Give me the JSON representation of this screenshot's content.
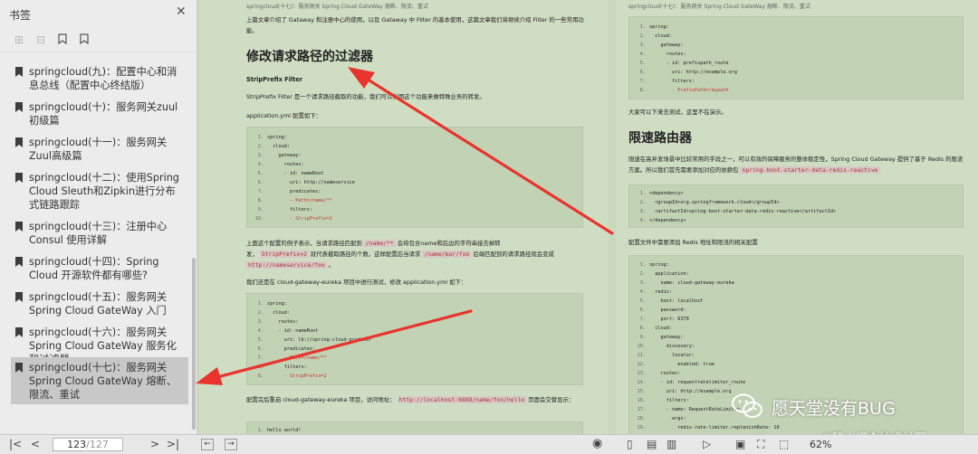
{
  "sidebar": {
    "title": "书签",
    "items": [
      {
        "label": "springcloud(九)：配置中心和消息总线（配置中心终结版）"
      },
      {
        "label": "springcloud(十)：服务网关zuul初级篇"
      },
      {
        "label": "springcloud(十一)：服务网关Zuul高级篇"
      },
      {
        "label": "springcloud(十二)：使用Spring Cloud Sleuth和Zipkin进行分布式链路跟踪"
      },
      {
        "label": "springcloud(十三)：注册中心 Consul 使用详解"
      },
      {
        "label": "springcloud(十四)：Spring Cloud 开源软件都有哪些?"
      },
      {
        "label": "springcloud(十五)：服务网关 Spring Cloud GateWay 入门"
      },
      {
        "label": "springcloud(十六)：服务网关 Spring Cloud GateWay 服务化和过滤器"
      },
      {
        "label": "springcloud(十七)：服务网关 Spring Cloud GateWay 熔断、限流、重试"
      }
    ]
  },
  "toolbar": {
    "current_page": "123",
    "total_pages": "/127",
    "zoom": "62%"
  },
  "left_page": {
    "running_head": "springcloud(十七)：服务网关 Spring Cloud GateWay 熔断、限流、重试",
    "intro": "上篇文章介绍了 Gataway 和注册中心的使用，以及 Gataway 中 Filter 的基本使用，这篇文章我们将继续介绍 Filter 的一些常用功能。",
    "h1": "修改请求路径的过滤器",
    "h2": "StripPrefix Filter",
    "p1": "StripPrefix Filter 是一个请求路径截取的功能，我们可以利用这个功能来做特殊业务的转发。",
    "p2": "application.yml 配置如下：",
    "code1": [
      "spring:",
      "  cloud:",
      "    gateway:",
      "      routes:",
      "      - id: nameRoot",
      "        uri: http://nameservice",
      "        predicates:",
      "        - Path=/name/**",
      "        filters:",
      "        - StripPrefix=2"
    ],
    "p3a": "上面这个配置的例子表示，当请求路径匹配到",
    "p3tag1": "/name/**",
    "p3b": "会将包含name和后边的字符串接去掉转",
    "p3c": "发，",
    "p3tag2": "StripPrefix=2",
    "p3d": "就代表截取路径的个数，这样配置后当请求",
    "p3tag3": "/name/bar/foo",
    "p3e": "后端匹配到的请求路径就会变成",
    "p3tag4": "http://nameservice/foo",
    "p3f": "。",
    "p4": "我们还是在 cloud-gateway-eureka 项目中进行测试，修改 application.yml 如下：",
    "code2": [
      "spring:",
      "  cloud:",
      "    routes:",
      "    - id: nameRoot",
      "      uri: lb://spring-cloud-producer",
      "      predicates:",
      "      - Path=/name/**",
      "      filters:",
      "      - StripPrefix=2"
    ],
    "p5a": "配置完后重启 cloud-gateway-eureka 项目，访问地址：",
    "p5tag": "http://localhost:8888/name/foo/hello",
    "p5b": "页面会交替显示：",
    "code3": [
      "hello world!"
    ]
  },
  "right_page": {
    "running_head": "springcloud(十七)：服务网关 Spring Cloud GateWay 熔断、限流、重试",
    "code1": [
      "spring:",
      "  cloud:",
      "    gateway:",
      "      routes:",
      "      - id: prefixpath_route",
      "        uri: http://example.org",
      "        filters:",
      "        - PrefixPath=/mypath"
    ],
    "p1": "大家可以下来去测试，这里不在演示。",
    "h1": "限速路由器",
    "p2a": "限速在高并发场景中比较常用的手段之一，可以有效的保障服务的整体稳定性，Spring Cloud Gateway 提供了基于 Redis 的限流方案。所以我们首先需要添加对应的依赖包",
    "p2tag": "spring-boot-starter-data-redis-reactive",
    "code2": [
      "<dependency>",
      "  <groupId>org.springframework.cloud</groupId>",
      "  <artifactId>spring-boot-starter-data-redis-reactive</artifactId>",
      "</dependency>"
    ],
    "p3": "配置文件中需要添加 Redis 地址和限流的相关配置",
    "code3": [
      "spring:",
      "  application:",
      "    name: cloud-gateway-eureka",
      "  redis:",
      "    host: localhost",
      "    password:",
      "    port: 6379",
      "  cloud:",
      "    gateway:",
      "      discovery:",
      "        locator:",
      "          enabled: true",
      "    routes:",
      "    - id: requestratelimiter_route",
      "      uri: http://example.org",
      "      filters:",
      "      - name: RequestRateLimiter",
      "        args:",
      "          redis-rate-limiter.replenishRate: 10"
    ]
  },
  "watermark": {
    "text": "愿天堂没有BUG",
    "text2": "@稀土掘金技术社区"
  },
  "colors": {
    "page_bg": "#cfddc3",
    "code_bg": "#c2d2b5",
    "arrow": "#e8342c"
  }
}
